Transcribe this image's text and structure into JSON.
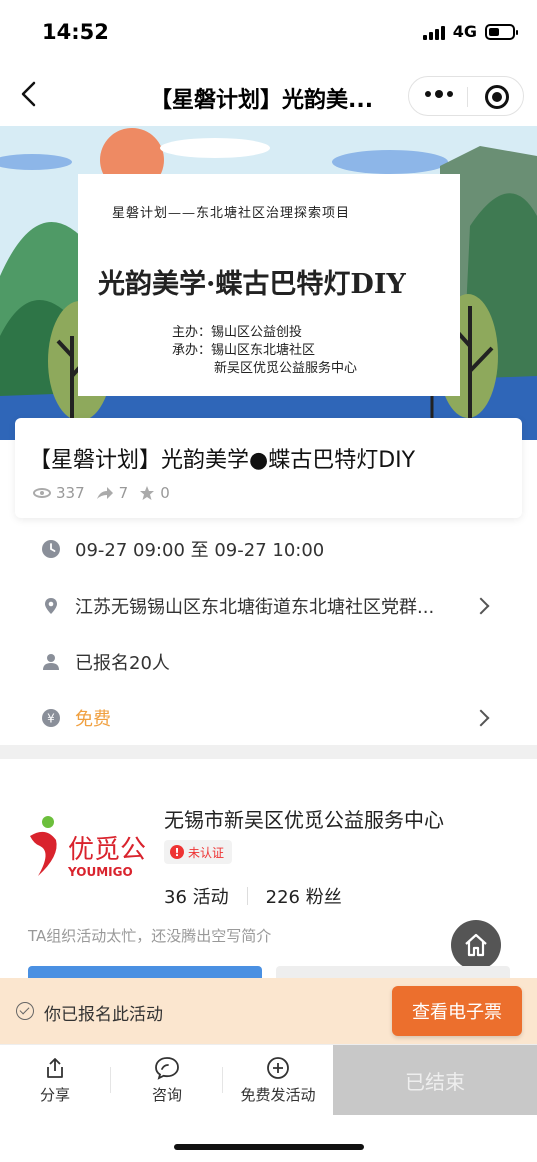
{
  "status_bar": {
    "time": "14:52",
    "network": "4G"
  },
  "nav": {
    "title": "【星磐计划】光韵美..."
  },
  "banner": {
    "subtitle": "星磐计划——东北塘社区治理探索项目",
    "main_title": "光韵美学·蝶古巴特灯DIY",
    "org_lines": [
      "主办：锡山区公益创投",
      "承办：锡山区东北塘社区",
      "新吴区优觅公益服务中心"
    ]
  },
  "event": {
    "title": "【星磐计划】光韵美学●蝶古巴特灯DIY",
    "views": "337",
    "shares": "7",
    "stars": "0"
  },
  "info": {
    "time": "09-27 09:00 至 09-27 10:00",
    "location": "江苏无锡锡山区东北塘街道东北塘社区党群...",
    "registered": "已报名20人",
    "fee": "免费"
  },
  "org": {
    "logo_text": "优觅公",
    "logo_sub": "YOUMIGO",
    "name": "无锡市新吴区优觅公益服务中心",
    "badge": "未认证",
    "activities": "36 活动",
    "fans": "226 粉丝",
    "desc": "TA组织活动太忙，还没腾出空写简介"
  },
  "registration": {
    "status": "你已报名此活动",
    "ticket_button": "查看电子票"
  },
  "tabbar": {
    "share": "分享",
    "consult": "咨询",
    "publish": "免费发活动",
    "ended": "已结束"
  },
  "colors": {
    "accent_orange": "#ec6f2d",
    "fee_orange": "#f0a040",
    "unverified_red": "#e33333"
  }
}
